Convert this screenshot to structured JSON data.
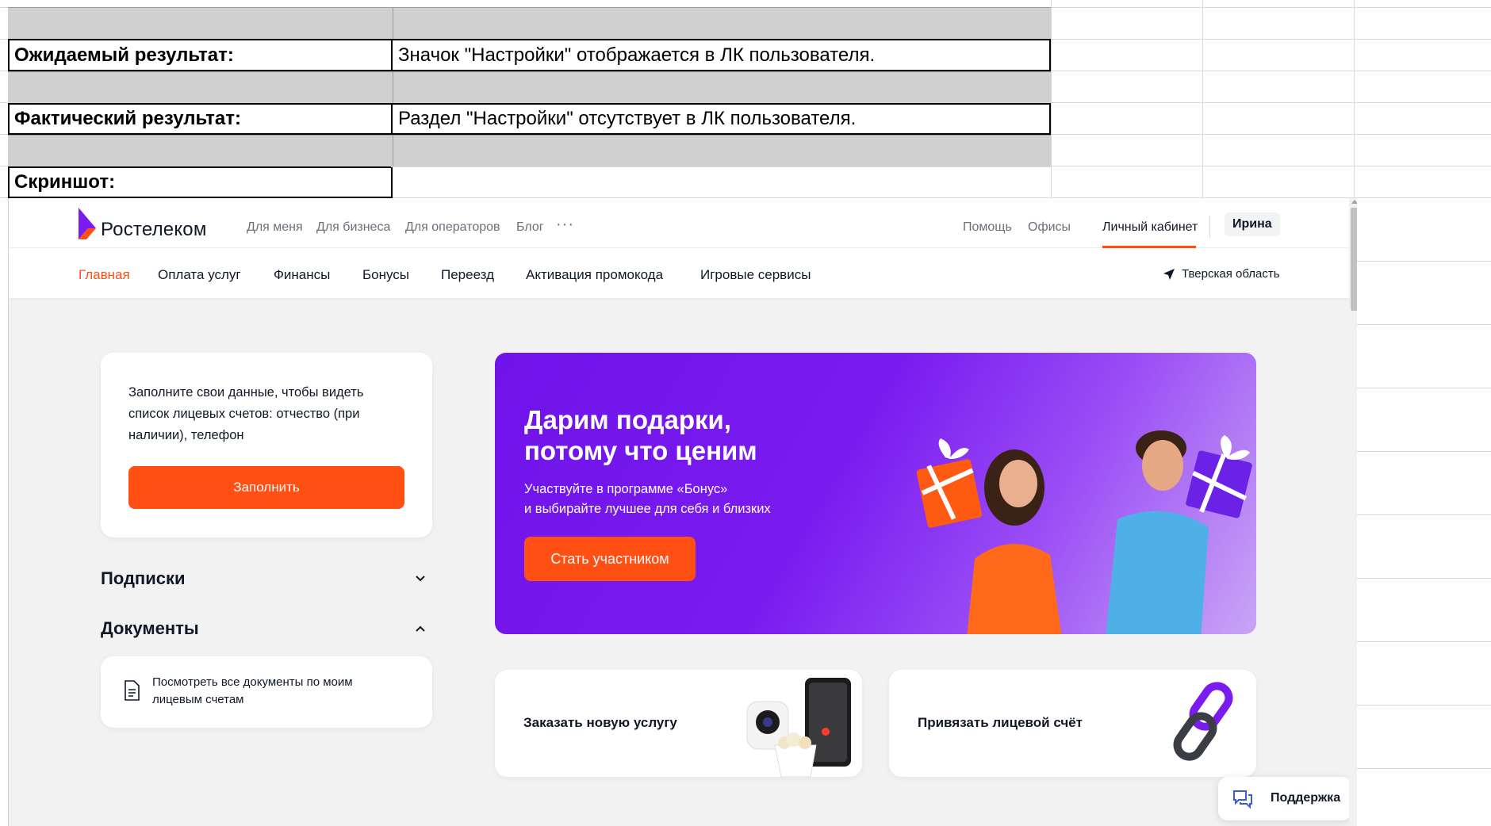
{
  "sheet": {
    "rows": [
      {
        "label": "Ожидаемый результат:",
        "value": "Значок \"Настройки\" отображается в ЛК пользователя."
      },
      {
        "label": "Фактический результат:",
        "value": "Раздел \"Настройки\" отсутствует в ЛК пользователя."
      },
      {
        "label": "Скриншот:",
        "value": ""
      }
    ]
  },
  "site": {
    "logo_text": "Ростелеком",
    "top_links": [
      "Для меня",
      "Для бизнеса",
      "Для операторов",
      "Блог"
    ],
    "more_label": "···",
    "help": "Помощь",
    "offices": "Офисы",
    "cabinet": "Личный кабинет",
    "user": "Ирина",
    "nav": [
      "Главная",
      "Оплата услуг",
      "Финансы",
      "Бонусы",
      "Переезд",
      "Активация промокода",
      "Игровые сервисы"
    ],
    "region": "Тверская область",
    "fill_card": {
      "text": "Заполните свои данные, чтобы видеть список лицевых счетов: отчество (при наличии), телефон",
      "button": "Заполнить"
    },
    "subscriptions": "Подписки",
    "documents": "Документы",
    "documents_link": "Посмотреть все документы по моим лицевым счетам",
    "banner": {
      "title_line1": "Дарим подарки,",
      "title_line2": "потому что ценим",
      "sub_line1": "Участвуйте в программе «Бонус»",
      "sub_line2": "и выбирайте лучшее для себя и близких",
      "button": "Стать участником"
    },
    "service_order": "Заказать новую услугу",
    "link_account": "Привязать лицевой счёт",
    "support": "Поддержка",
    "colors": {
      "accent": "#ff4f12",
      "purple": "#7a1cf0",
      "text": "#101828"
    }
  }
}
